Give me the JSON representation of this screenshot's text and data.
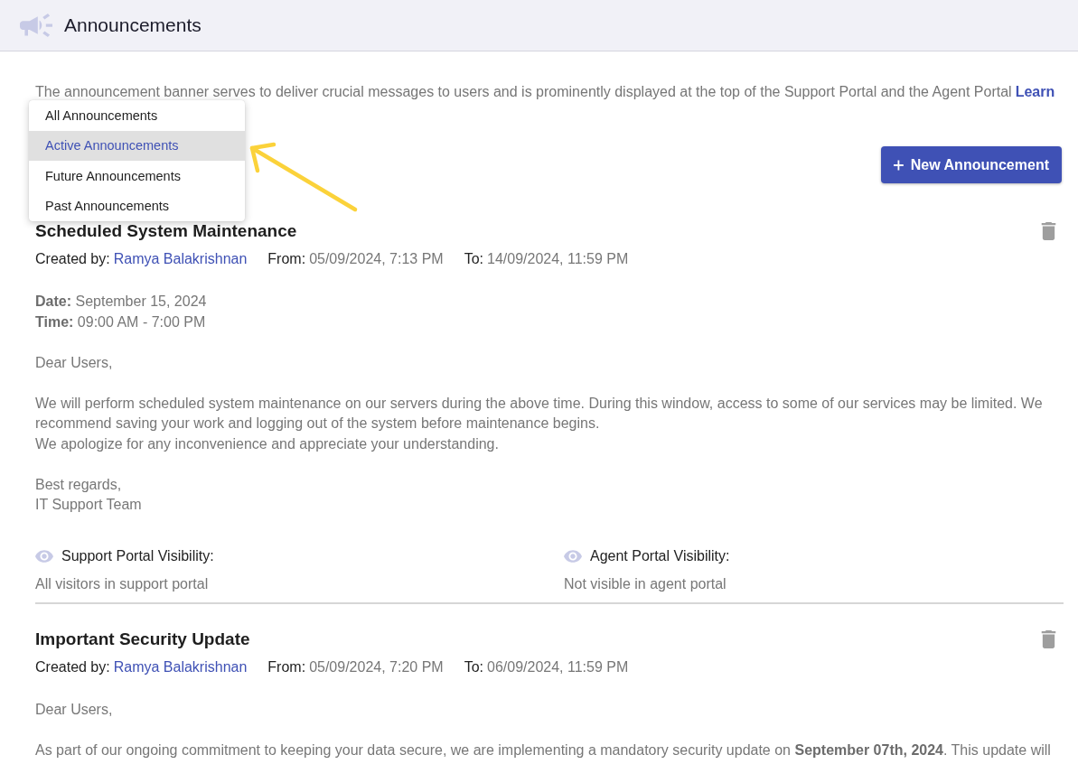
{
  "header": {
    "title": "Announcements"
  },
  "intro": {
    "text": "The announcement banner serves to deliver crucial messages to users and is prominently displayed at the top of the Support Portal and the Agent Portal",
    "link": "Learn"
  },
  "filter_menu": {
    "items": [
      {
        "label": "All Announcements",
        "selected": false
      },
      {
        "label": "Active Announcements",
        "selected": true
      },
      {
        "label": "Future Announcements",
        "selected": false
      },
      {
        "label": "Past Announcements",
        "selected": false
      }
    ]
  },
  "annotation_arrow": true,
  "new_button": {
    "label": "New Announcement"
  },
  "announcements": [
    {
      "title": "Scheduled System Maintenance",
      "created_by_label": "Created by:",
      "author": "Ramya Balakrishnan",
      "from_label": "From:",
      "from": "05/09/2024, 7:13 PM",
      "to_label": "To:",
      "to": "14/09/2024, 11:59 PM",
      "body": [
        [
          "**Date:** September 15, 2024",
          "**Time:** 09:00 AM - 7:00 PM"
        ],
        [
          "Dear Users,"
        ],
        [
          "We will perform scheduled system maintenance on our servers during the above time. During this window, access to some of our services may be limited. We recommend saving your work and logging out of the system before maintenance begins.",
          "We apologize for any inconvenience and appreciate your understanding."
        ],
        [
          "Best regards,",
          "IT Support Team"
        ]
      ],
      "visibility": [
        {
          "label": "Support Portal Visibility:",
          "value": "All visitors in support portal"
        },
        {
          "label": "Agent Portal Visibility:",
          "value": "Not visible in agent portal"
        }
      ]
    },
    {
      "title": "Important Security Update",
      "created_by_label": "Created by:",
      "author": "Ramya Balakrishnan",
      "from_label": "From:",
      "from": "05/09/2024, 7:20 PM",
      "to_label": "To:",
      "to": "06/09/2024, 11:59 PM",
      "body": [
        [
          "Dear Users,"
        ],
        [
          "As part of our ongoing commitment to keeping your data secure, we are implementing a mandatory security update on **September 07th, 2024**. This update will"
        ]
      ]
    }
  ]
}
